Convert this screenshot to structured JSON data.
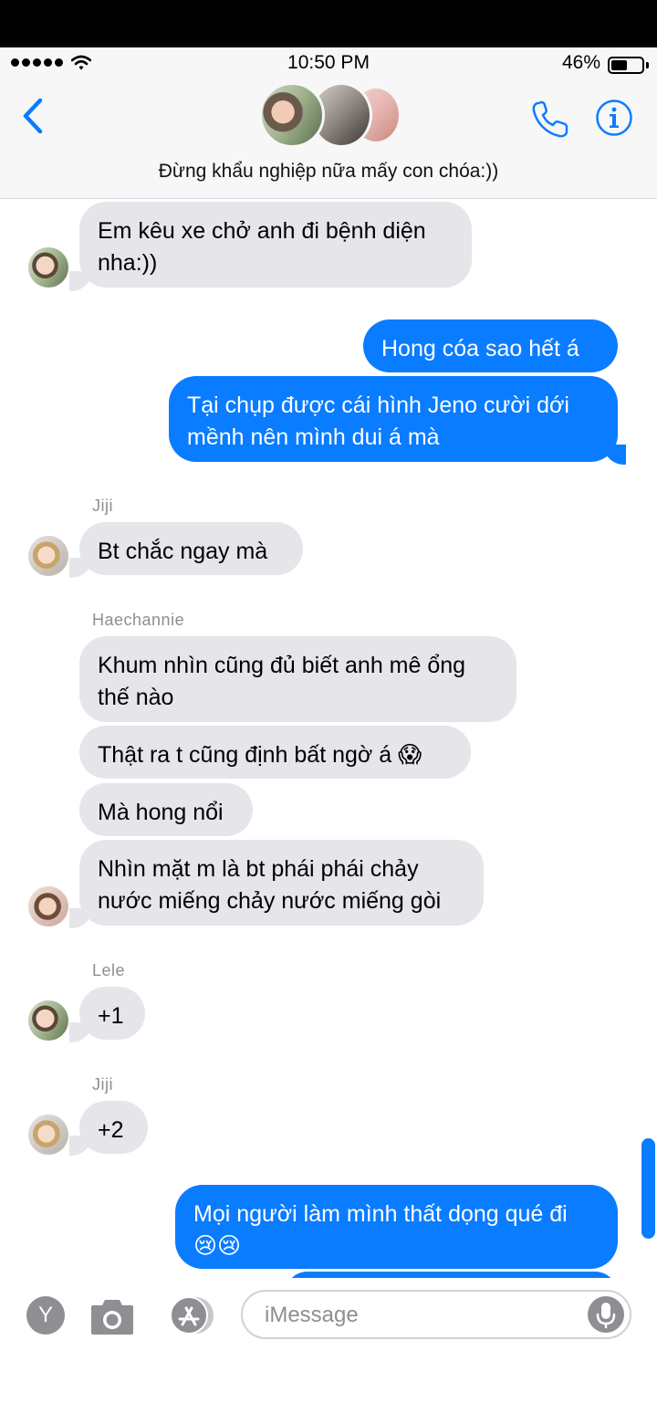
{
  "status_bar": {
    "time": "10:50 PM",
    "battery_percent": "46%",
    "battery_level": 0.46,
    "signal_dots": 5
  },
  "header": {
    "group_name": "Đừng khẩu nghiệp nữa mấy con chóa:))",
    "icons": {
      "back": "chevron-left-icon",
      "call": "phone-icon",
      "info": "info-icon"
    }
  },
  "messages": [
    {
      "from": "them",
      "text": "Em kêu xe chở anh đi bệnh diện\nnha:))"
    },
    {
      "from": "me",
      "text": "Hong cóa sao hết á"
    },
    {
      "from": "me",
      "text": "Tại chụp được cái hình Jeno cười dới\nmềnh nên mình dui á mà"
    },
    {
      "from": "them",
      "sender": "Jiji",
      "text": "Bt chắc ngay mà"
    },
    {
      "from": "them",
      "sender": "Haechannie",
      "text": "Khum nhìn cũng đủ biết anh mê ổng\nthế nào"
    },
    {
      "from": "them",
      "text": "Thật ra t cũng định bất ngờ á 😱"
    },
    {
      "from": "them",
      "text": "Mà hong nổi"
    },
    {
      "from": "them",
      "text": "Nhìn mặt m là bt phái phái chảy\nnước miếng chảy nước miếng gòi"
    },
    {
      "from": "them",
      "sender": "Lele",
      "text": "+1"
    },
    {
      "from": "them",
      "sender": "Jiji",
      "text": "+2"
    },
    {
      "from": "me",
      "text": "Mọi người làm mình thất dọng qué đi\n😢😢"
    }
  ],
  "input_bar": {
    "apps_button_label": "Y",
    "placeholder": "iMessage",
    "icons": {
      "camera": "camera-icon",
      "app_store": "app-store-icon",
      "mic": "microphone-icon"
    }
  },
  "colors": {
    "outgoing_bubble": "#0a7cff",
    "incoming_bubble": "#e5e5ea",
    "accent": "#0a7cff"
  }
}
